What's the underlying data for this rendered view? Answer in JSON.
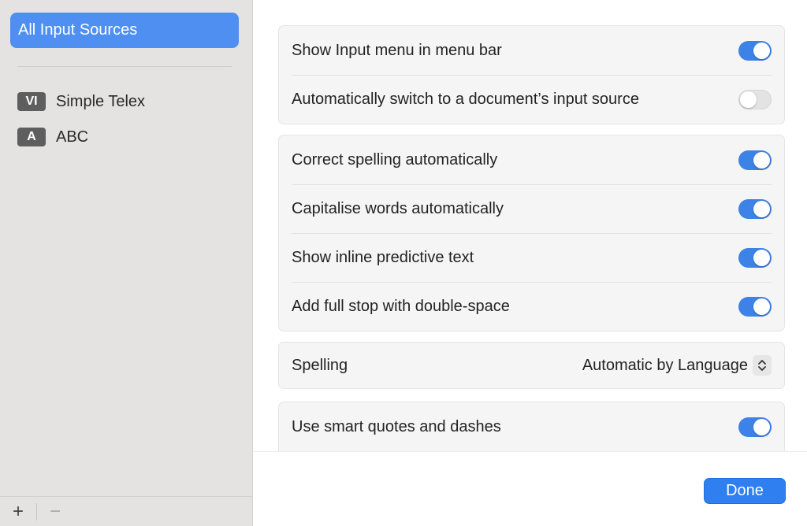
{
  "sidebar": {
    "selected_label": "All Input Sources",
    "sources": [
      {
        "badge": "VI",
        "label": "Simple Telex"
      },
      {
        "badge": "A",
        "label": "ABC"
      }
    ],
    "add_label": "+",
    "remove_label": "−"
  },
  "groups": {
    "menu": [
      {
        "label": "Show Input menu in menu bar",
        "on": true
      },
      {
        "label": "Automatically switch to a document’s input source",
        "on": false
      }
    ],
    "typing": [
      {
        "label": "Correct spelling automatically",
        "on": true
      },
      {
        "label": "Capitalise words automatically",
        "on": true
      },
      {
        "label": "Show inline predictive text",
        "on": true
      },
      {
        "label": "Add full stop with double-space",
        "on": true
      }
    ],
    "spelling": {
      "label": "Spelling",
      "value": "Automatic by Language"
    },
    "quotes": [
      {
        "label": "Use smart quotes and dashes",
        "on": true
      }
    ]
  },
  "footer": {
    "done_label": "Done"
  },
  "colors": {
    "accent": "#3d82e6",
    "sidebar_bg": "#e4e3e1",
    "selected_bg": "#4f8ff2"
  }
}
